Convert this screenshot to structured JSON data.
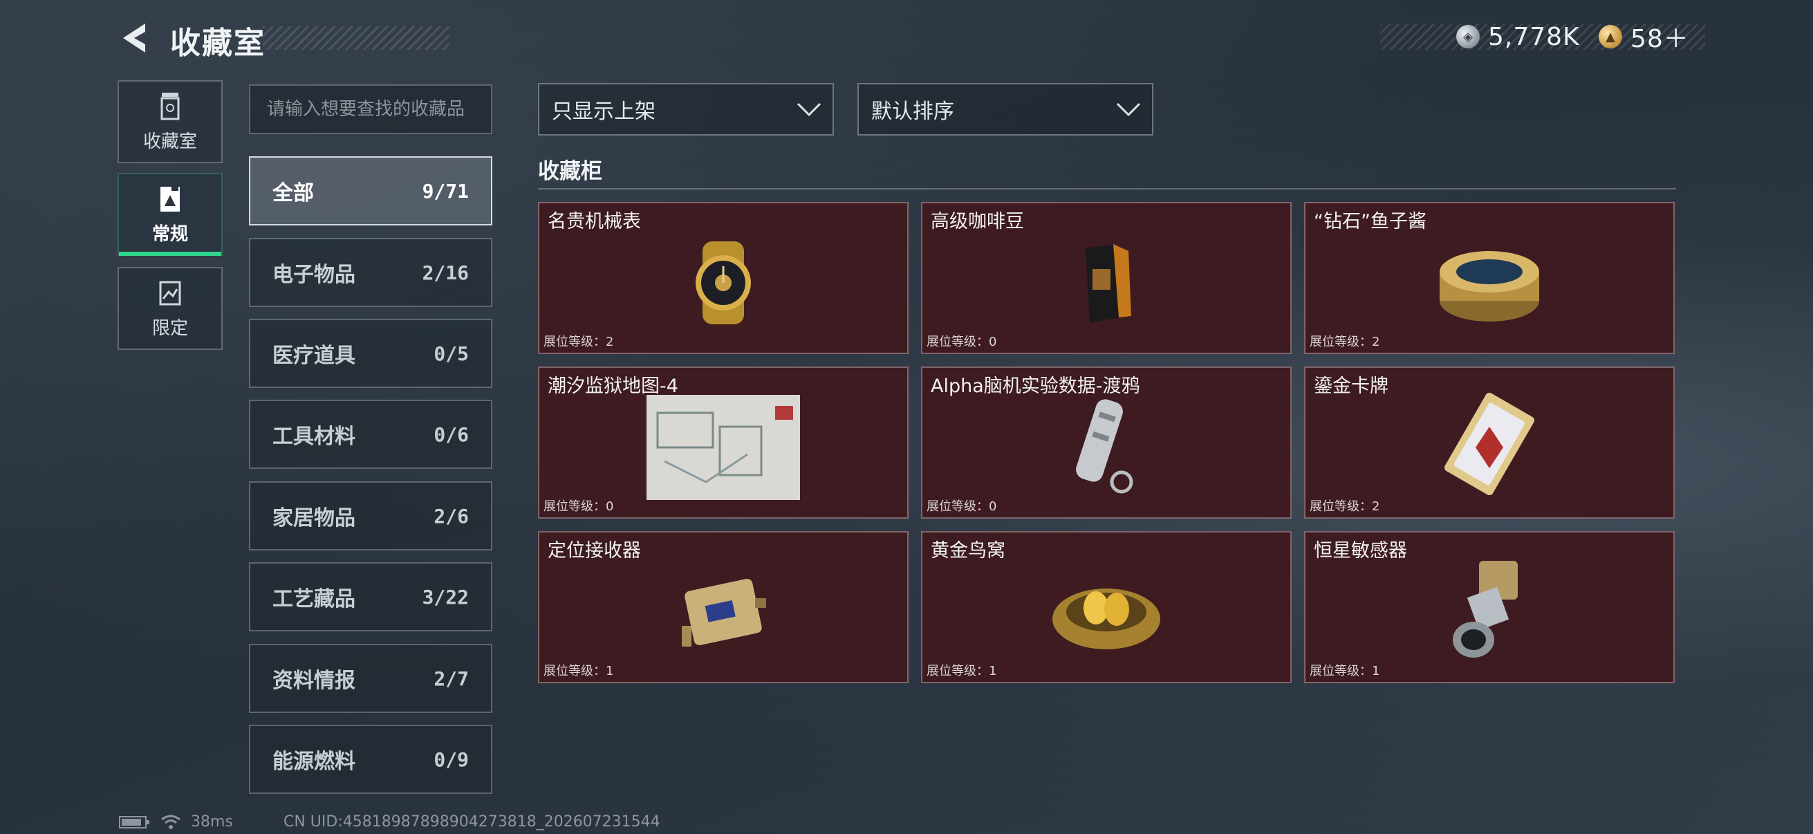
{
  "header": {
    "title": "收藏室",
    "back_icon": "back-arrow-icon"
  },
  "currency": [
    {
      "icon": "silver-coin-icon",
      "value": "5,778K"
    },
    {
      "icon": "gold-coin-icon",
      "value": "58＋"
    }
  ],
  "nav": [
    {
      "label": "收藏室",
      "icon": "collection-room-icon",
      "active": false
    },
    {
      "label": "常规",
      "icon": "regular-collection-icon",
      "active": true
    },
    {
      "label": "限定",
      "icon": "limited-collection-icon",
      "active": false
    }
  ],
  "search": {
    "placeholder": "请输入想要查找的收藏品",
    "value": ""
  },
  "categories": [
    {
      "name": "全部",
      "count": "9/71",
      "active": true
    },
    {
      "name": "电子物品",
      "count": "2/16"
    },
    {
      "name": "医疗道具",
      "count": "0/5"
    },
    {
      "name": "工具材料",
      "count": "0/6"
    },
    {
      "name": "家居物品",
      "count": "2/6"
    },
    {
      "name": "工艺藏品",
      "count": "3/22"
    },
    {
      "name": "资料情报",
      "count": "2/7"
    },
    {
      "name": "能源燃料",
      "count": "0/9"
    }
  ],
  "filters": {
    "display_filter": "只显示上架",
    "sort": "默认排序"
  },
  "section": {
    "title": "收藏柜"
  },
  "items": [
    {
      "name": "名贵机械表",
      "level": "展位等级：2",
      "icon": "gold-watch-icon"
    },
    {
      "name": "高级咖啡豆",
      "level": "展位等级：0",
      "icon": "coffee-bag-icon"
    },
    {
      "name": "“钻石”鱼子酱",
      "level": "展位等级：2",
      "icon": "caviar-tin-icon"
    },
    {
      "name": "潮汐监狱地图-4",
      "level": "展位等级：0",
      "icon": "prison-map-icon"
    },
    {
      "name": "Alpha脑机实验数据-渡鸦",
      "level": "展位等级：0",
      "icon": "data-drive-icon"
    },
    {
      "name": "鎏金卡牌",
      "level": "展位等级：2",
      "icon": "gilded-card-icon"
    },
    {
      "name": "定位接收器",
      "level": "展位等级：1",
      "icon": "receiver-device-icon"
    },
    {
      "name": "黄金鸟窝",
      "level": "展位等级：1",
      "icon": "golden-nest-icon"
    },
    {
      "name": "恒星敏感器",
      "level": "展位等级：1",
      "icon": "star-sensor-icon"
    }
  ],
  "footer": {
    "ping": "38ms",
    "uid": "CN UID:4581898789890427381‌8_202607231544"
  }
}
